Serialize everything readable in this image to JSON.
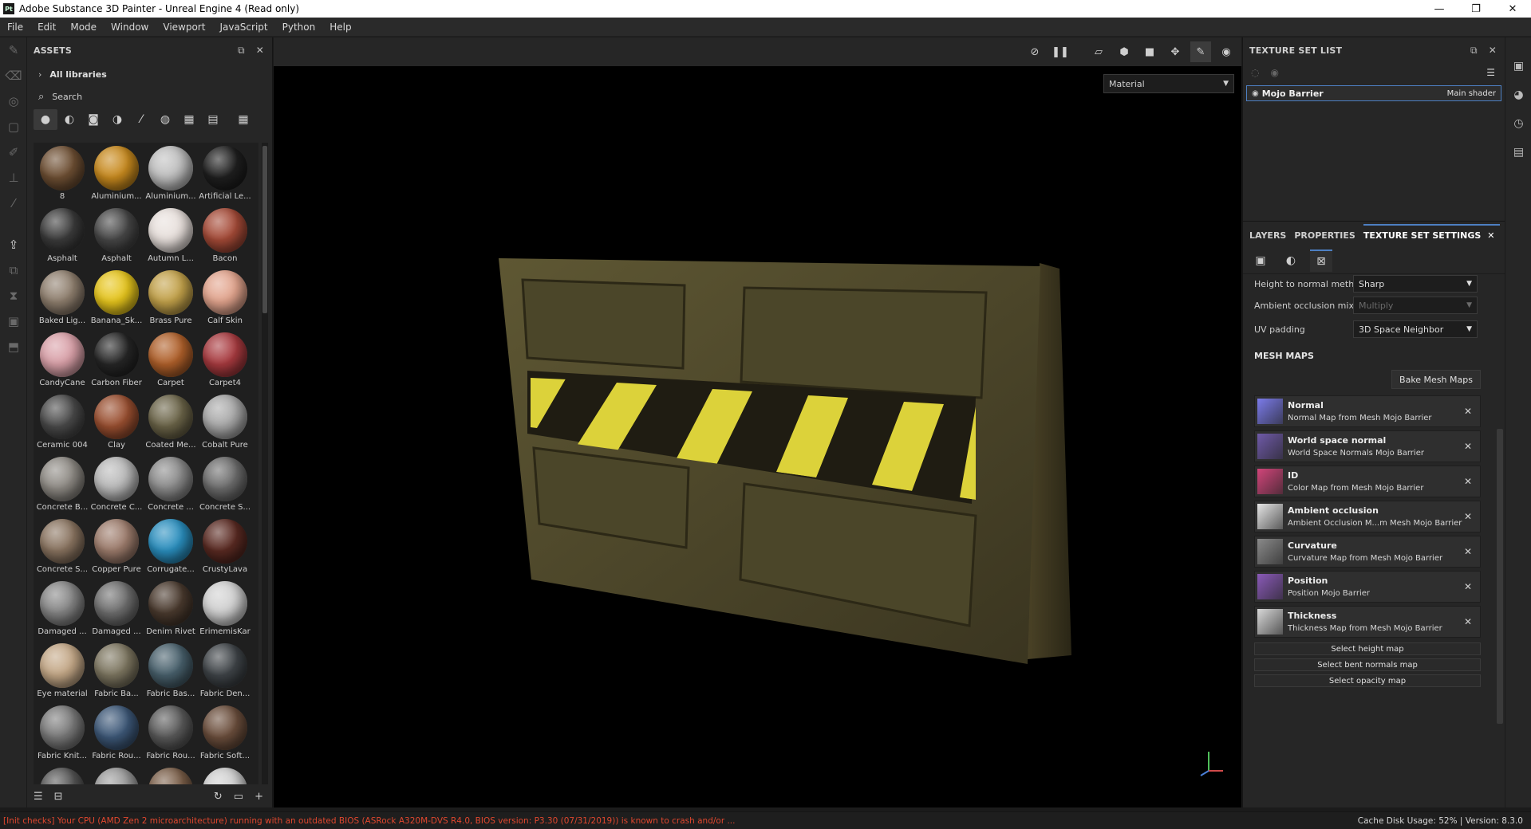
{
  "window": {
    "title": "Adobe Substance 3D Painter - Unreal Engine 4 (Read only)",
    "app_icon_text": "Pt",
    "controls": [
      "—",
      "❐",
      "✕"
    ]
  },
  "menu": [
    "File",
    "Edit",
    "Mode",
    "Window",
    "Viewport",
    "JavaScript",
    "Python",
    "Help"
  ],
  "assets": {
    "title": "ASSETS",
    "library": "All libraries",
    "search_placeholder": "Search",
    "items": [
      {
        "label": "8",
        "color": "#6e4f33"
      },
      {
        "label": "Aluminium...",
        "color": "#c88a1e"
      },
      {
        "label": "Aluminium...",
        "color": "#bfbfbf"
      },
      {
        "label": "Artificial Le...",
        "color": "#1f1f1f"
      },
      {
        "label": "Asphalt",
        "color": "#3b3b3b"
      },
      {
        "label": "Asphalt",
        "color": "#474747"
      },
      {
        "label": "Autumn L...",
        "color": "#e8e0dc"
      },
      {
        "label": "Bacon",
        "color": "#a54a37"
      },
      {
        "label": "Baked Lig...",
        "color": "#8f7f6e"
      },
      {
        "label": "Banana_Sk...",
        "color": "#e6c51c"
      },
      {
        "label": "Brass Pure",
        "color": "#c3a24a"
      },
      {
        "label": "Calf Skin",
        "color": "#e2a48d"
      },
      {
        "label": "CandyCane",
        "color": "#d9a0a8"
      },
      {
        "label": "Carbon Fiber",
        "color": "#262626"
      },
      {
        "label": "Carpet",
        "color": "#b0602a"
      },
      {
        "label": "Carpet4",
        "color": "#a83a3f"
      },
      {
        "label": "Ceramic 004",
        "color": "#4a4a4a"
      },
      {
        "label": "Clay",
        "color": "#9a4f30"
      },
      {
        "label": "Coated Me...",
        "color": "#6b6448"
      },
      {
        "label": "Cobalt Pure",
        "color": "#a8a8a8"
      },
      {
        "label": "Concrete B...",
        "color": "#8e8a84"
      },
      {
        "label": "Concrete C...",
        "color": "#b9b9b9"
      },
      {
        "label": "Concrete ...",
        "color": "#8a8a8a"
      },
      {
        "label": "Concrete S...",
        "color": "#6c6c6c"
      },
      {
        "label": "Concrete S...",
        "color": "#8a7460"
      },
      {
        "label": "Copper Pure",
        "color": "#9d7c6c"
      },
      {
        "label": "Corrugate...",
        "color": "#2a8fbf"
      },
      {
        "label": "CrustyLava",
        "color": "#5a2a22"
      },
      {
        "label": "Damaged ...",
        "color": "#858585"
      },
      {
        "label": "Damaged ...",
        "color": "#6e6e6e"
      },
      {
        "label": "Denim Rivet",
        "color": "#4a3a2e"
      },
      {
        "label": "ErimemisKar",
        "color": "#d0d0d0"
      },
      {
        "label": "Eye material",
        "color": "#c4a887"
      },
      {
        "label": "Fabric Ba...",
        "color": "#7d7660"
      },
      {
        "label": "Fabric Bas...",
        "color": "#48606c"
      },
      {
        "label": "Fabric Den...",
        "color": "#3f4448"
      },
      {
        "label": "Fabric Knit...",
        "color": "#7a7a7a"
      },
      {
        "label": "Fabric Rou...",
        "color": "#3d5878"
      },
      {
        "label": "Fabric Rou...",
        "color": "#5a5a5a"
      },
      {
        "label": "Fabric Soft...",
        "color": "#6b4e3c"
      },
      {
        "label": "",
        "color": "#555555"
      },
      {
        "label": "",
        "color": "#9a9a9a"
      },
      {
        "label": "",
        "color": "#7a5e48"
      },
      {
        "label": "",
        "color": "#cfcfcf"
      }
    ]
  },
  "viewport": {
    "mode_select": "Material"
  },
  "texture_set_list": {
    "title": "TEXTURE SET LIST",
    "item_name": "Mojo Barrier",
    "item_shader": "Main shader"
  },
  "tabs": {
    "layers": "LAYERS",
    "properties": "PROPERTIES",
    "texture_set_settings": "TEXTURE SET SETTINGS",
    "close": "✕"
  },
  "settings": {
    "height_to_normal_label": "Height to normal method",
    "height_to_normal_value": "Sharp",
    "ao_mixing_label": "Ambient occlusion mixing",
    "ao_mixing_value": "Multiply",
    "uv_padding_label": "UV padding",
    "uv_padding_value": "3D Space Neighbor"
  },
  "mesh_maps": {
    "title": "MESH MAPS",
    "bake_button": "Bake Mesh Maps",
    "maps": [
      {
        "title": "Normal",
        "sub": "Normal Map from Mesh Mojo Barrier",
        "color": "#7b7bea"
      },
      {
        "title": "World space normal",
        "sub": "World Space Normals Mojo Barrier",
        "color": "#6f5aa8"
      },
      {
        "title": "ID",
        "sub": "Color Map from Mesh Mojo Barrier",
        "color": "#d2457a"
      },
      {
        "title": "Ambient occlusion",
        "sub": "Ambient Occlusion M...m Mesh Mojo Barrier",
        "color": "#e6e6e6"
      },
      {
        "title": "Curvature",
        "sub": "Curvature Map from Mesh Mojo Barrier",
        "color": "#8a8a8a"
      },
      {
        "title": "Position",
        "sub": "Position Mojo Barrier",
        "color": "#8a5ab8"
      },
      {
        "title": "Thickness",
        "sub": "Thickness Map from Mesh Mojo Barrier",
        "color": "#d8d8d8"
      }
    ],
    "select_height": "Select height map",
    "select_bent": "Select bent normals map",
    "select_opacity": "Select opacity map"
  },
  "status": {
    "error": "[Init checks] Your CPU (AMD Zen 2 microarchitecture) running with an outdated BIOS (ASRock A320M-DVS R4.0, BIOS version: P3.30 (07/31/2019)) is known to crash and/or ...",
    "right": "Cache Disk Usage:   52% | Version: 8.3.0"
  }
}
